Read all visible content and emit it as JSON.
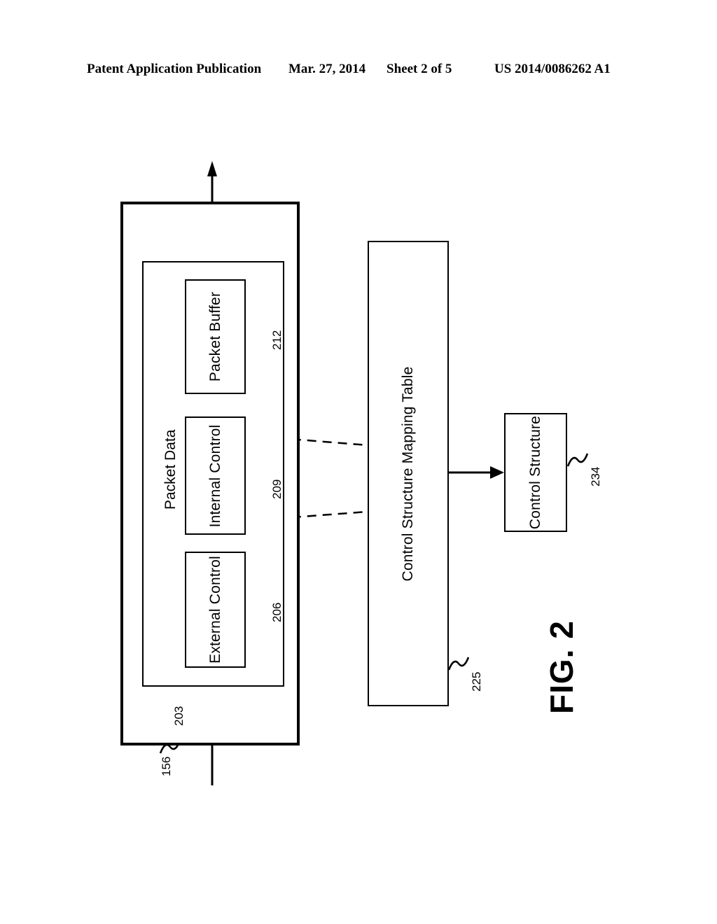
{
  "header": {
    "publication": "Patent Application Publication",
    "date": "Mar. 27, 2014",
    "sheet": "Sheet 2 of 5",
    "patent_number": "US 2014/0086262 A1"
  },
  "figure": {
    "caption": "FIG. 2"
  },
  "diagram": {
    "outer_container": {
      "label": "",
      "ref": "156"
    },
    "packet_data": {
      "label": "Packet Data",
      "ref": "203"
    },
    "blocks": [
      {
        "label": "Packet Buffer",
        "ref": "212"
      },
      {
        "label": "Internal Control",
        "ref": "209"
      },
      {
        "label": "External Control",
        "ref": "206"
      }
    ],
    "mapping_table": {
      "label": "Control Structure Mapping Table",
      "ref": "225"
    },
    "control_structure": {
      "label": "Control Structure",
      "ref": "234"
    }
  }
}
